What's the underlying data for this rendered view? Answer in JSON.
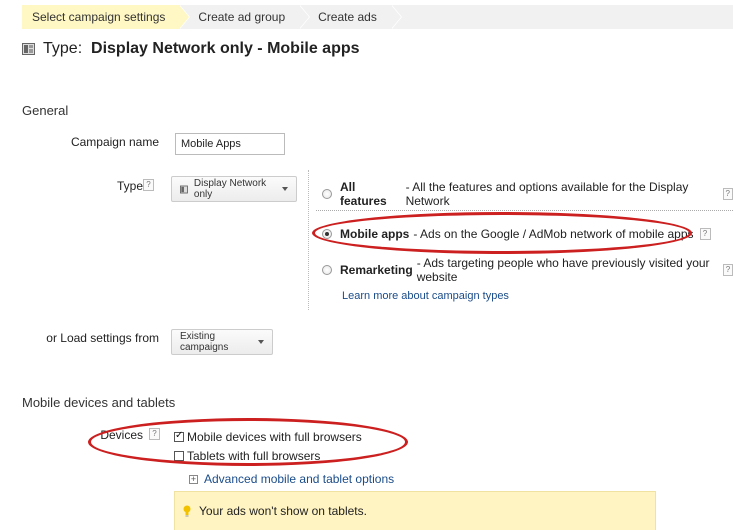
{
  "breadcrumb": {
    "items": [
      {
        "label": "Select campaign settings"
      },
      {
        "label": "Create ad group"
      },
      {
        "label": "Create ads"
      }
    ]
  },
  "header": {
    "type_prefix": "Type:",
    "type_value": "Display Network only - Mobile apps"
  },
  "general": {
    "section_title": "General",
    "campaign_name_label": "Campaign name",
    "campaign_name_value": "Mobile Apps",
    "type_label": "Type",
    "type_dropdown": "Display Network only",
    "options": [
      {
        "name": "All features",
        "desc": " - All the features and options available for the Display Network",
        "checked": false
      },
      {
        "name": "Mobile apps",
        "desc": " - Ads on the Google / AdMob network of mobile apps",
        "checked": true
      },
      {
        "name": "Remarketing",
        "desc": " - Ads targeting people who have previously visited your website",
        "checked": false
      }
    ],
    "learn_more": "Learn more about campaign types",
    "load_label": "or Load settings from",
    "load_dropdown": "Existing campaigns"
  },
  "devices": {
    "section_title": "Mobile devices and tablets",
    "label": "Devices",
    "options": [
      {
        "label": "Mobile devices with full browsers",
        "checked": true
      },
      {
        "label": "Tablets with full browsers",
        "checked": false
      }
    ],
    "advanced_link": "Advanced mobile and tablet options",
    "notice": "Your ads won't show on tablets."
  },
  "help_glyph": "?",
  "annotation_color": "#cc1f1f"
}
